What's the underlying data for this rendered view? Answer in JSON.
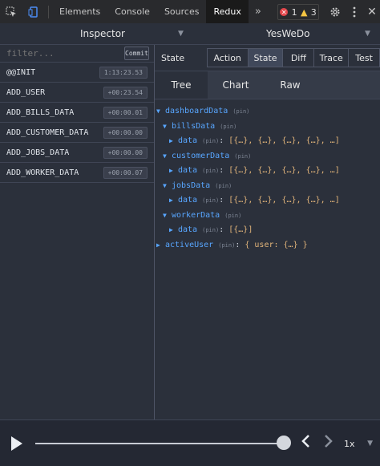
{
  "devtools": {
    "tabs": [
      "Elements",
      "Console",
      "Sources",
      "Redux"
    ],
    "active_tab": "Redux",
    "more": "»",
    "errors": "1",
    "warnings": "3"
  },
  "header": {
    "left_title": "Inspector",
    "right_title": "YesWeDo"
  },
  "left_panel": {
    "filter_placeholder": "filter...",
    "commit_label": "Commit",
    "actions": [
      {
        "name": "@@INIT",
        "time": "1:13:23.53"
      },
      {
        "name": "ADD_USER",
        "time": "+00:23.54"
      },
      {
        "name": "ADD_BILLS_DATA",
        "time": "+00:00.01"
      },
      {
        "name": "ADD_CUSTOMER_DATA",
        "time": "+00:00.00"
      },
      {
        "name": "ADD_JOBS_DATA",
        "time": "+00:00.00"
      },
      {
        "name": "ADD_WORKER_DATA",
        "time": "+00:00.07"
      }
    ]
  },
  "right_panel": {
    "state_label": "State",
    "mode_buttons": [
      "Action",
      "State",
      "Diff",
      "Trace",
      "Test"
    ],
    "active_mode": "State",
    "view_tabs": [
      "Tree",
      "Chart",
      "Raw"
    ],
    "active_view": "Tree",
    "tree": {
      "dashboard_key": "dashboardData",
      "pin": "(pin)",
      "bills_key": "billsData",
      "customer_key": "customerData",
      "jobs_key": "jobsData",
      "worker_key": "workerData",
      "data_key": "data",
      "five_items": "[{…}, {…}, {…}, {…}, …]",
      "one_item": "[{…}]",
      "active_user_key": "activeUser",
      "active_user_val": "{ user: {…} }"
    }
  },
  "playback": {
    "speed": "1x",
    "progress": 1.0
  }
}
